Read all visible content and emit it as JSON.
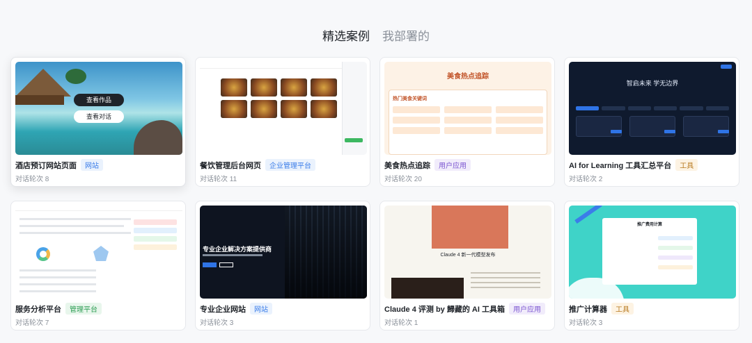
{
  "tabs": [
    {
      "label": "精选案例",
      "active": true
    },
    {
      "label": "我部署的",
      "active": false
    }
  ],
  "cards": [
    {
      "title": "酒店预订网站页面",
      "tag": "网站",
      "tag_type": "site",
      "rounds": "对话轮次 8",
      "hover_buttons": [
        "查看作品",
        "查看对话"
      ]
    },
    {
      "title": "餐饮管理后台网页",
      "tag": "企业管理平台",
      "tag_type": "enterprise",
      "rounds": "对话轮次 11"
    },
    {
      "title": "美食热点追踪",
      "tag": "用户应用",
      "tag_type": "user",
      "rounds": "对话轮次 20",
      "thumb_title": "美食热点追踪",
      "thumb_panel": "热门美食关键词"
    },
    {
      "title": "AI for Learning 工具汇总平台",
      "tag": "工具",
      "tag_type": "tool",
      "rounds": "对话轮次 2",
      "thumb_title": "智启未来 学无边界"
    },
    {
      "title": "服务分析平台",
      "tag": "管理平台",
      "tag_type": "mgmt",
      "rounds": "对话轮次 7"
    },
    {
      "title": "专业企业网站",
      "tag": "网站",
      "tag_type": "site",
      "rounds": "对话轮次 3",
      "thumb_title": "专业企业解决方案提供商"
    },
    {
      "title": "Claude 4 评测 by 歸藏的 AI 工具箱",
      "tag": "用户应用",
      "tag_type": "user",
      "rounds": "对话轮次 1",
      "thumb_title": "Claude 4 新一代模型发布"
    },
    {
      "title": "推广计算器",
      "tag": "工具",
      "tag_type": "tool",
      "rounds": "对话轮次 3",
      "thumb_title": "推广费用计算"
    }
  ]
}
